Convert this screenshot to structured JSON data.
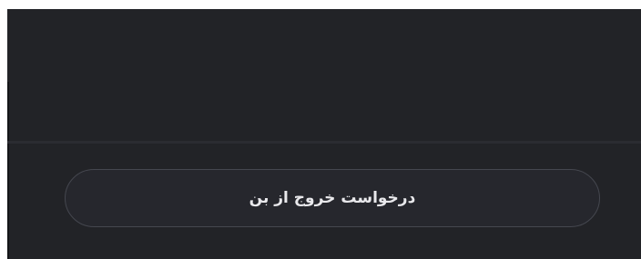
{
  "theme": {
    "background": "#222327",
    "divider": "#2b2c31",
    "button_background": "#26272d",
    "button_border": "#45474f",
    "button_text": "#e9e9ec"
  },
  "footer": {
    "leave_request_label": "درخواست خروج از بن"
  }
}
